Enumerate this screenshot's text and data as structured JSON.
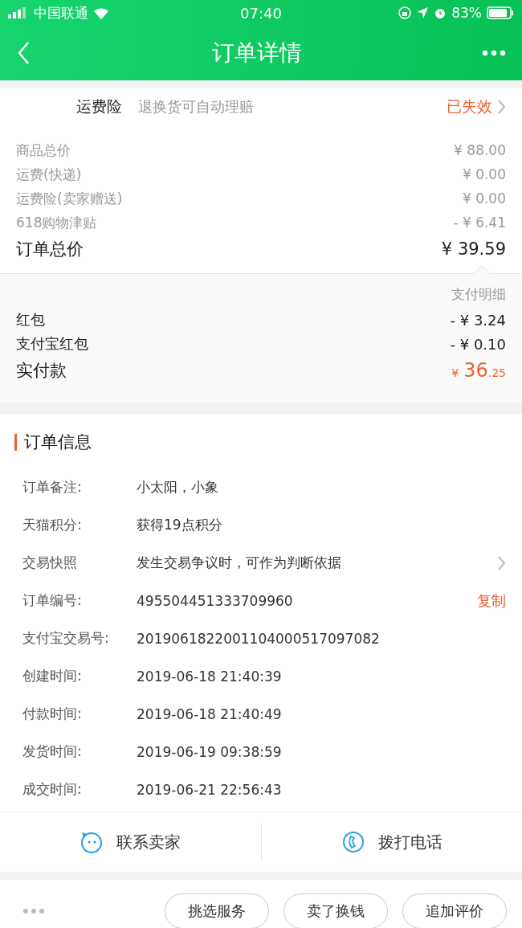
{
  "status_bar": {
    "carrier": "中国联通",
    "time": "07:40",
    "battery": "83%"
  },
  "nav": {
    "title": "订单详情"
  },
  "insurance": {
    "label": "运费险",
    "description": "退换货可自动理赔",
    "status": "已失效"
  },
  "price_summary": {
    "items": [
      {
        "label": "商品总价",
        "value": "¥ 88.00",
        "kind": "minor"
      },
      {
        "label": "运费(快递)",
        "value": "¥ 0.00",
        "kind": "minor"
      },
      {
        "label": "运费险(卖家赠送)",
        "value": "¥ 0.00",
        "kind": "minor"
      },
      {
        "label": "618购物津贴",
        "value": "- ¥ 6.41",
        "kind": "minor"
      },
      {
        "label": "订单总价",
        "value": "¥ 39.59",
        "kind": "total"
      }
    ]
  },
  "payment": {
    "detail_link": "支付明细",
    "items": [
      {
        "label": "红包",
        "value": "- ¥ 3.24"
      },
      {
        "label": "支付宝红包",
        "value": "- ¥ 0.10"
      }
    ],
    "paid": {
      "label": "实付款",
      "currency": "¥",
      "amount": "36",
      "cents": ".25"
    }
  },
  "order_info": {
    "title": "订单信息",
    "rows": [
      {
        "label": "订单备注:",
        "value": "小太阳，小象",
        "kind": "plain"
      },
      {
        "label": "天猫积分:",
        "value": "获得19点积分",
        "kind": "plain"
      },
      {
        "label": "交易快照",
        "value": "发生交易争议时，可作为判断依据",
        "kind": "chevron"
      },
      {
        "label": "订单编号:",
        "value": "495504451333709960",
        "kind": "action",
        "action": "复制"
      },
      {
        "label": "支付宝交易号:",
        "value": "2019061822001104000517097082",
        "kind": "plain"
      },
      {
        "label": "创建时间:",
        "value": "2019-06-18 21:40:39",
        "kind": "plain"
      },
      {
        "label": "付款时间:",
        "value": "2019-06-18 21:40:49",
        "kind": "plain"
      },
      {
        "label": "发货时间:",
        "value": "2019-06-19 09:38:59",
        "kind": "plain"
      },
      {
        "label": "成交时间:",
        "value": "2019-06-21 22:56:43",
        "kind": "plain"
      }
    ]
  },
  "contact": [
    {
      "label": "联系卖家",
      "kind": "chat"
    },
    {
      "label": "拨打电话",
      "kind": "phone"
    }
  ],
  "actions": [
    {
      "label": "挑选服务"
    },
    {
      "label": "卖了换钱"
    },
    {
      "label": "追加评价"
    }
  ]
}
